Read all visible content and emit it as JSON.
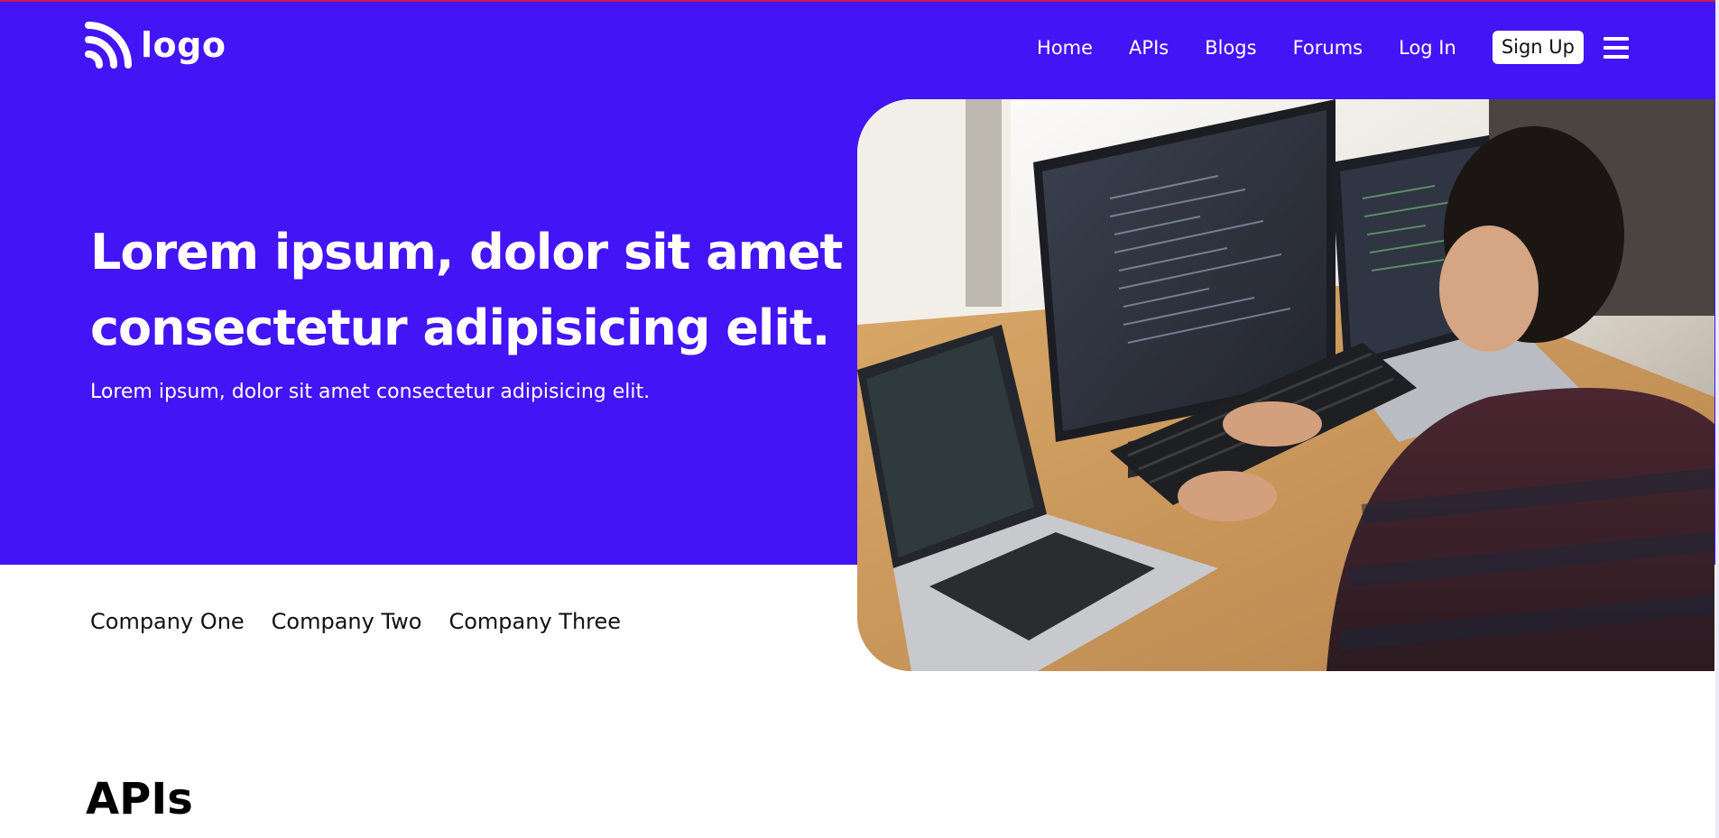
{
  "brand": {
    "logo_text": "logo",
    "accent_color": "#4314f5"
  },
  "nav": {
    "items": [
      "Home",
      "APIs",
      "Blogs",
      "Forums",
      "Log In"
    ],
    "signup_label": "Sign Up",
    "menu_icon": "hamburger-menu-icon"
  },
  "hero": {
    "headline_line1": "Lorem ipsum, dolor sit amet",
    "headline_line2": "consectetur adipisicing elit.",
    "subtitle": "Lorem ipsum, dolor sit amet consectetur adipisicing elit.",
    "image": "developer-at-computers-photo"
  },
  "companies": [
    "Company One",
    "Company Two",
    "Company Three"
  ],
  "sections": {
    "apis_title": "APIs"
  }
}
